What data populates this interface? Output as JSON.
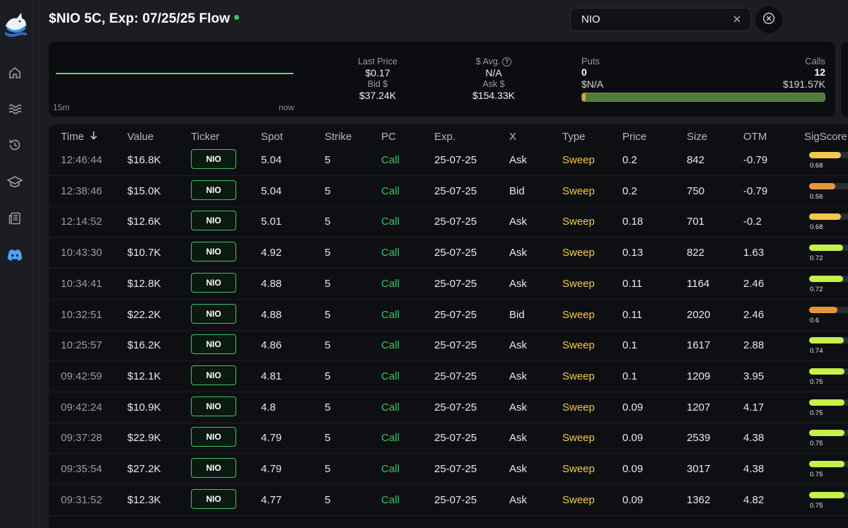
{
  "header": {
    "title": "$NIO 5C, Exp: 07/25/25 Flow"
  },
  "search": {
    "value": "NIO"
  },
  "sidebar": {
    "items": [
      {
        "icon": "home-icon"
      },
      {
        "icon": "waves-icon"
      },
      {
        "icon": "history-icon"
      },
      {
        "icon": "graduation-cap-icon"
      },
      {
        "icon": "newspaper-icon"
      },
      {
        "icon": "discord-icon"
      }
    ]
  },
  "summary": {
    "range_start": "15m",
    "range_end": "now",
    "last_price_label": "Last Price",
    "last_price": "$0.17",
    "bid_label": "Bid $",
    "bid": "$37.24K",
    "avg_label": "$ Avg.",
    "avg": "N/A",
    "ask_label": "Ask $",
    "ask": "$154.33K",
    "puts_label": "Puts",
    "puts_count": "0",
    "puts_premium": "$N/A",
    "calls_label": "Calls",
    "calls_count": "12",
    "calls_premium": "$191.57K",
    "calls_fraction": 0.985
  },
  "table": {
    "columns": [
      "Time",
      "Value",
      "Ticker",
      "Spot",
      "Strike",
      "PC",
      "Exp.",
      "X",
      "Type",
      "Price",
      "Size",
      "OTM",
      "SigScore"
    ],
    "rows": [
      {
        "time": "12:46:44",
        "value": "$16.8K",
        "ticker": "NIO",
        "spot": "5.04",
        "strike": "5",
        "pc": "Call",
        "exp": "25-07-25",
        "x": "Ask",
        "type": "Sweep",
        "price": "0.2",
        "size": "842",
        "otm": "-0.79",
        "sig": "0.68",
        "sig_color": "#f2c94c"
      },
      {
        "time": "12:38:46",
        "value": "$15.0K",
        "ticker": "NIO",
        "spot": "5.04",
        "strike": "5",
        "pc": "Call",
        "exp": "25-07-25",
        "x": "Bid",
        "type": "Sweep",
        "price": "0.2",
        "size": "750",
        "otm": "-0.79",
        "sig": "0.56",
        "sig_color": "#e8953a"
      },
      {
        "time": "12:14:52",
        "value": "$12.6K",
        "ticker": "NIO",
        "spot": "5.01",
        "strike": "5",
        "pc": "Call",
        "exp": "25-07-25",
        "x": "Ask",
        "type": "Sweep",
        "price": "0.18",
        "size": "701",
        "otm": "-0.2",
        "sig": "0.68",
        "sig_color": "#f2c94c"
      },
      {
        "time": "10:43:30",
        "value": "$10.7K",
        "ticker": "NIO",
        "spot": "4.92",
        "strike": "5",
        "pc": "Call",
        "exp": "25-07-25",
        "x": "Ask",
        "type": "Sweep",
        "price": "0.13",
        "size": "822",
        "otm": "1.63",
        "sig": "0.72",
        "sig_color": "#c6f04a"
      },
      {
        "time": "10:34:41",
        "value": "$12.8K",
        "ticker": "NIO",
        "spot": "4.88",
        "strike": "5",
        "pc": "Call",
        "exp": "25-07-25",
        "x": "Ask",
        "type": "Sweep",
        "price": "0.11",
        "size": "1164",
        "otm": "2.46",
        "sig": "0.72",
        "sig_color": "#c6f04a"
      },
      {
        "time": "10:32:51",
        "value": "$22.2K",
        "ticker": "NIO",
        "spot": "4.88",
        "strike": "5",
        "pc": "Call",
        "exp": "25-07-25",
        "x": "Bid",
        "type": "Sweep",
        "price": "0.11",
        "size": "2020",
        "otm": "2.46",
        "sig": "0.6",
        "sig_color": "#e8953a"
      },
      {
        "time": "10:25:57",
        "value": "$16.2K",
        "ticker": "NIO",
        "spot": "4.86",
        "strike": "5",
        "pc": "Call",
        "exp": "25-07-25",
        "x": "Ask",
        "type": "Sweep",
        "price": "0.1",
        "size": "1617",
        "otm": "2.88",
        "sig": "0.74",
        "sig_color": "#c6f04a"
      },
      {
        "time": "09:42:59",
        "value": "$12.1K",
        "ticker": "NIO",
        "spot": "4.81",
        "strike": "5",
        "pc": "Call",
        "exp": "25-07-25",
        "x": "Ask",
        "type": "Sweep",
        "price": "0.1",
        "size": "1209",
        "otm": "3.95",
        "sig": "0.75",
        "sig_color": "#c6f04a"
      },
      {
        "time": "09:42:24",
        "value": "$10.9K",
        "ticker": "NIO",
        "spot": "4.8",
        "strike": "5",
        "pc": "Call",
        "exp": "25-07-25",
        "x": "Ask",
        "type": "Sweep",
        "price": "0.09",
        "size": "1207",
        "otm": "4.17",
        "sig": "0.75",
        "sig_color": "#c6f04a"
      },
      {
        "time": "09:37:28",
        "value": "$22.9K",
        "ticker": "NIO",
        "spot": "4.79",
        "strike": "5",
        "pc": "Call",
        "exp": "25-07-25",
        "x": "Ask",
        "type": "Sweep",
        "price": "0.09",
        "size": "2539",
        "otm": "4.38",
        "sig": "0.75",
        "sig_color": "#c6f04a"
      },
      {
        "time": "09:35:54",
        "value": "$27.2K",
        "ticker": "NIO",
        "spot": "4.79",
        "strike": "5",
        "pc": "Call",
        "exp": "25-07-25",
        "x": "Ask",
        "type": "Sweep",
        "price": "0.09",
        "size": "3017",
        "otm": "4.38",
        "sig": "0.75",
        "sig_color": "#c6f04a"
      },
      {
        "time": "09:31:52",
        "value": "$12.3K",
        "ticker": "NIO",
        "spot": "4.77",
        "strike": "5",
        "pc": "Call",
        "exp": "25-07-25",
        "x": "Ask",
        "type": "Sweep",
        "price": "0.09",
        "size": "1362",
        "otm": "4.82",
        "sig": "0.75",
        "sig_color": "#c6f04a"
      }
    ]
  }
}
